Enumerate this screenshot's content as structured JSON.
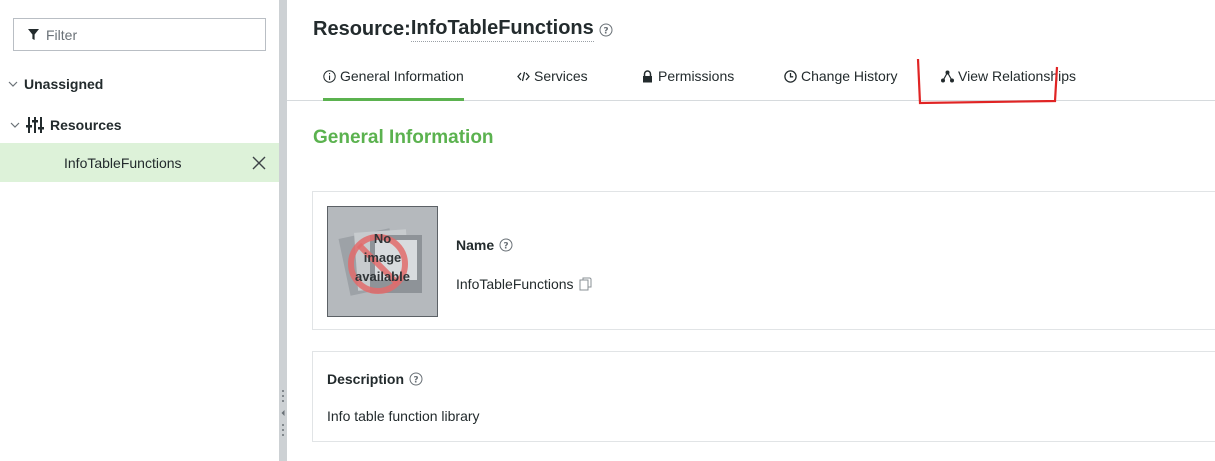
{
  "sidebar": {
    "filter_placeholder": "Filter",
    "tree": {
      "unassigned_label": "Unassigned",
      "resources_label": "Resources",
      "selected_item_label": "InfoTableFunctions"
    }
  },
  "header": {
    "title_prefix": "Resource:",
    "title_name": "InfoTableFunctions"
  },
  "tabs": [
    {
      "label": "General Information",
      "icon": "info-circle-icon",
      "active": true
    },
    {
      "label": "Services",
      "icon": "code-icon",
      "active": false
    },
    {
      "label": "Permissions",
      "icon": "lock-icon",
      "active": false
    },
    {
      "label": "Change History",
      "icon": "clock-icon",
      "active": false
    },
    {
      "label": "View Relationships",
      "icon": "hierarchy-icon",
      "active": false
    }
  ],
  "content": {
    "section_title": "General Information",
    "thumbnail_text": [
      "No",
      "image",
      "available"
    ],
    "name_label": "Name",
    "name_value": "InfoTableFunctions",
    "description_label": "Description",
    "description_value": "Info table function library"
  },
  "colors": {
    "accent": "#5bb24f",
    "selected_bg": "#ddf2d9",
    "annotation": "#e02424"
  }
}
